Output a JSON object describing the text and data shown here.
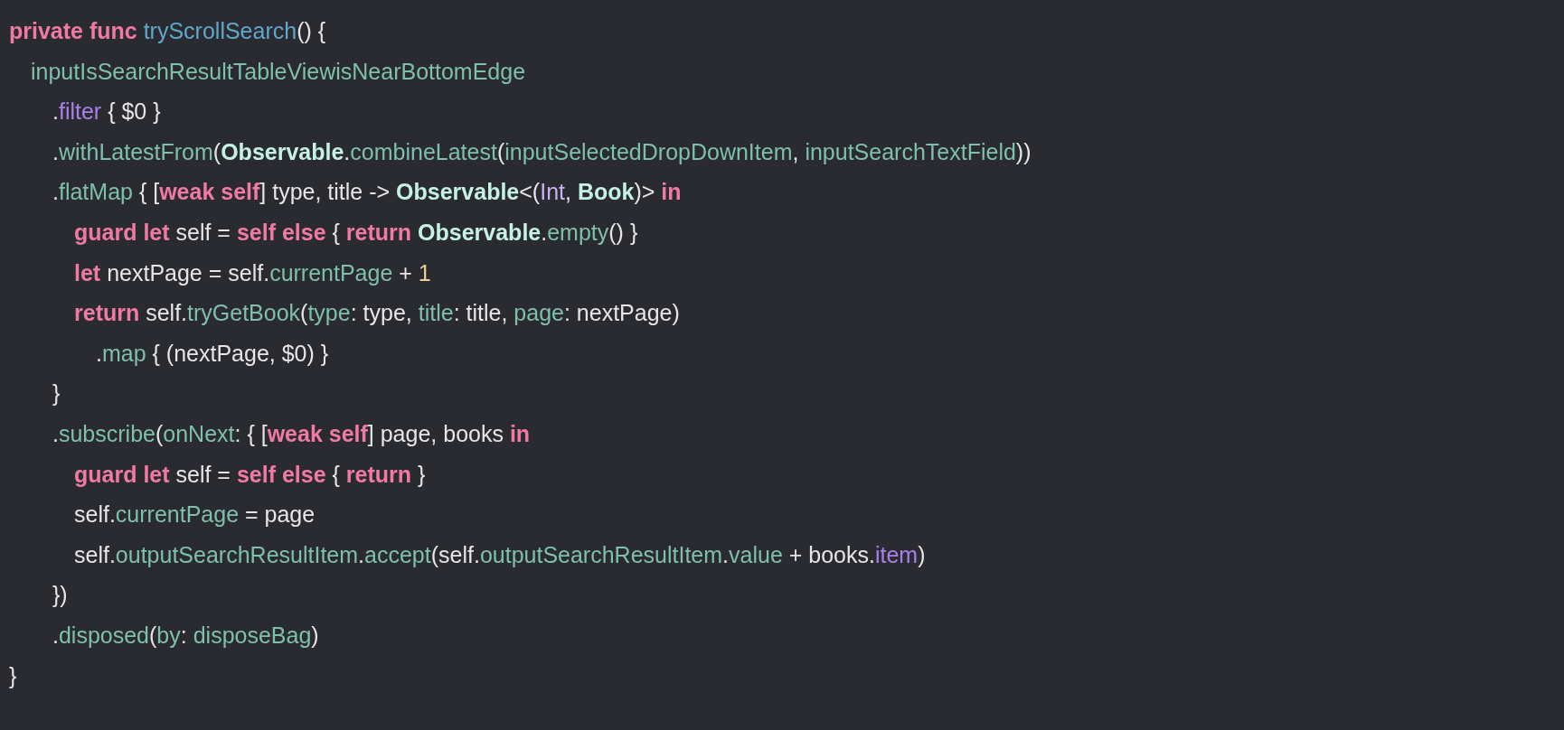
{
  "code_lines": [
    {
      "tokens": [
        {
          "kind": "keyword",
          "text": "private func "
        },
        {
          "kind": "function",
          "text": "tryScrollSearch"
        },
        {
          "kind": "plain",
          "text": "() {"
        }
      ]
    },
    {
      "tokens": [
        {
          "kind": "property",
          "text": "\tinputIsSearchResultTableViewisNearBottomEdge"
        }
      ]
    },
    {
      "tokens": [
        {
          "kind": "plain",
          "text": "\t\t."
        },
        {
          "kind": "method",
          "text": "filter"
        },
        {
          "kind": "plain",
          "text": " { $0 }"
        }
      ]
    },
    {
      "tokens": [
        {
          "kind": "plain",
          "text": "\t\t."
        },
        {
          "kind": "property",
          "text": "withLatestFrom"
        },
        {
          "kind": "plain",
          "text": "("
        },
        {
          "kind": "type",
          "text": "Observable"
        },
        {
          "kind": "plain",
          "text": "."
        },
        {
          "kind": "property",
          "text": "combineLatest"
        },
        {
          "kind": "plain",
          "text": "("
        },
        {
          "kind": "property",
          "text": "inputSelectedDropDownItem"
        },
        {
          "kind": "plain",
          "text": ", "
        },
        {
          "kind": "property",
          "text": "inputSearchTextField"
        },
        {
          "kind": "plain",
          "text": "))"
        }
      ]
    },
    {
      "tokens": [
        {
          "kind": "plain",
          "text": "\t\t."
        },
        {
          "kind": "property",
          "text": "flatMap"
        },
        {
          "kind": "plain",
          "text": " { ["
        },
        {
          "kind": "keyword",
          "text": "weak self"
        },
        {
          "kind": "plain",
          "text": "] type, title -> "
        },
        {
          "kind": "type",
          "text": "Observable"
        },
        {
          "kind": "plain",
          "text": "<("
        },
        {
          "kind": "builtin",
          "text": "Int"
        },
        {
          "kind": "plain",
          "text": ", "
        },
        {
          "kind": "type",
          "text": "Book"
        },
        {
          "kind": "plain",
          "text": ")> "
        },
        {
          "kind": "keyword",
          "text": "in"
        }
      ]
    },
    {
      "tokens": [
        {
          "kind": "keyword",
          "text": "\t\t\tguard let"
        },
        {
          "kind": "plain",
          "text": " self = "
        },
        {
          "kind": "keyword",
          "text": "self else"
        },
        {
          "kind": "plain",
          "text": " { "
        },
        {
          "kind": "keyword",
          "text": "return "
        },
        {
          "kind": "type",
          "text": "Observable"
        },
        {
          "kind": "plain",
          "text": "."
        },
        {
          "kind": "property",
          "text": "empty"
        },
        {
          "kind": "plain",
          "text": "() }"
        }
      ]
    },
    {
      "tokens": [
        {
          "kind": "keyword",
          "text": "\t\t\tlet"
        },
        {
          "kind": "plain",
          "text": " nextPage = self."
        },
        {
          "kind": "property",
          "text": "currentPage"
        },
        {
          "kind": "plain",
          "text": " + "
        },
        {
          "kind": "number",
          "text": "1"
        }
      ]
    },
    {
      "tokens": [
        {
          "kind": "keyword",
          "text": "\t\t\treturn"
        },
        {
          "kind": "plain",
          "text": " self."
        },
        {
          "kind": "property",
          "text": "tryGetBook"
        },
        {
          "kind": "plain",
          "text": "("
        },
        {
          "kind": "property",
          "text": "type"
        },
        {
          "kind": "plain",
          "text": ": type, "
        },
        {
          "kind": "property",
          "text": "title"
        },
        {
          "kind": "plain",
          "text": ": title, "
        },
        {
          "kind": "property",
          "text": "page"
        },
        {
          "kind": "plain",
          "text": ": nextPage)"
        }
      ]
    },
    {
      "tokens": [
        {
          "kind": "plain",
          "text": "\t\t\t\t."
        },
        {
          "kind": "property",
          "text": "map"
        },
        {
          "kind": "plain",
          "text": " { (nextPage, $0) }"
        }
      ]
    },
    {
      "tokens": [
        {
          "kind": "plain",
          "text": "\t\t}"
        }
      ]
    },
    {
      "tokens": [
        {
          "kind": "plain",
          "text": "\t\t."
        },
        {
          "kind": "property",
          "text": "subscribe"
        },
        {
          "kind": "plain",
          "text": "("
        },
        {
          "kind": "property",
          "text": "onNext"
        },
        {
          "kind": "plain",
          "text": ": { ["
        },
        {
          "kind": "keyword",
          "text": "weak self"
        },
        {
          "kind": "plain",
          "text": "] page, books "
        },
        {
          "kind": "keyword",
          "text": "in"
        }
      ]
    },
    {
      "tokens": [
        {
          "kind": "keyword",
          "text": "\t\t\tguard let"
        },
        {
          "kind": "plain",
          "text": " self = "
        },
        {
          "kind": "keyword",
          "text": "self else"
        },
        {
          "kind": "plain",
          "text": " { "
        },
        {
          "kind": "keyword",
          "text": "return"
        },
        {
          "kind": "plain",
          "text": " }"
        }
      ]
    },
    {
      "tokens": [
        {
          "kind": "plain",
          "text": "\t\t\tself."
        },
        {
          "kind": "property",
          "text": "currentPage"
        },
        {
          "kind": "plain",
          "text": " = page"
        }
      ]
    },
    {
      "tokens": [
        {
          "kind": "plain",
          "text": "\t\t\tself."
        },
        {
          "kind": "property",
          "text": "outputSearchResultItem"
        },
        {
          "kind": "plain",
          "text": "."
        },
        {
          "kind": "property",
          "text": "accept"
        },
        {
          "kind": "plain",
          "text": "(self."
        },
        {
          "kind": "property",
          "text": "outputSearchResultItem"
        },
        {
          "kind": "plain",
          "text": "."
        },
        {
          "kind": "property",
          "text": "value"
        },
        {
          "kind": "plain",
          "text": " + books."
        },
        {
          "kind": "method",
          "text": "item"
        },
        {
          "kind": "plain",
          "text": ")"
        }
      ]
    },
    {
      "tokens": [
        {
          "kind": "plain",
          "text": "\t\t})"
        }
      ]
    },
    {
      "tokens": [
        {
          "kind": "plain",
          "text": "\t\t."
        },
        {
          "kind": "property",
          "text": "disposed"
        },
        {
          "kind": "plain",
          "text": "("
        },
        {
          "kind": "property",
          "text": "by"
        },
        {
          "kind": "plain",
          "text": ": "
        },
        {
          "kind": "property",
          "text": "disposeBag"
        },
        {
          "kind": "plain",
          "text": ")"
        }
      ]
    },
    {
      "tokens": [
        {
          "kind": "plain",
          "text": "}"
        }
      ]
    }
  ]
}
